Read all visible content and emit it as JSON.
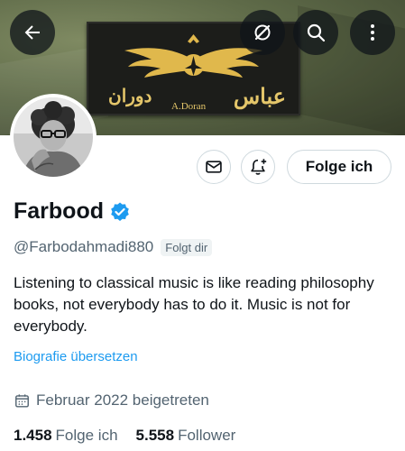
{
  "banner": {
    "patch_text_right": "عباس",
    "patch_text_left": "دوران",
    "patch_subtitle": "A.Doran"
  },
  "header_icons": {
    "back": "arrow-left-icon",
    "grok": "grok-icon",
    "search": "search-icon",
    "more": "more-vertical-icon"
  },
  "actions": {
    "message_icon": "envelope-icon",
    "notify_icon": "bell-plus-icon",
    "follow_label": "Folge ich"
  },
  "profile": {
    "name": "Farbood",
    "verified": true,
    "handle": "@Farbodahmadi880",
    "follows_you": "Folgt dir",
    "bio": "Listening to classical music is like reading philosophy books, not everybody has to do it. Music is not for everybody.",
    "translate_label": "Biografie übersetzen",
    "joined": "Februar 2022 beigetreten"
  },
  "stats": {
    "following_count": "1.458",
    "following_label": "Folge ich",
    "followers_count": "5.558",
    "followers_label": "Follower"
  },
  "colors": {
    "accent": "#1d9bf0",
    "muted": "#536471",
    "text": "#0f1419"
  }
}
